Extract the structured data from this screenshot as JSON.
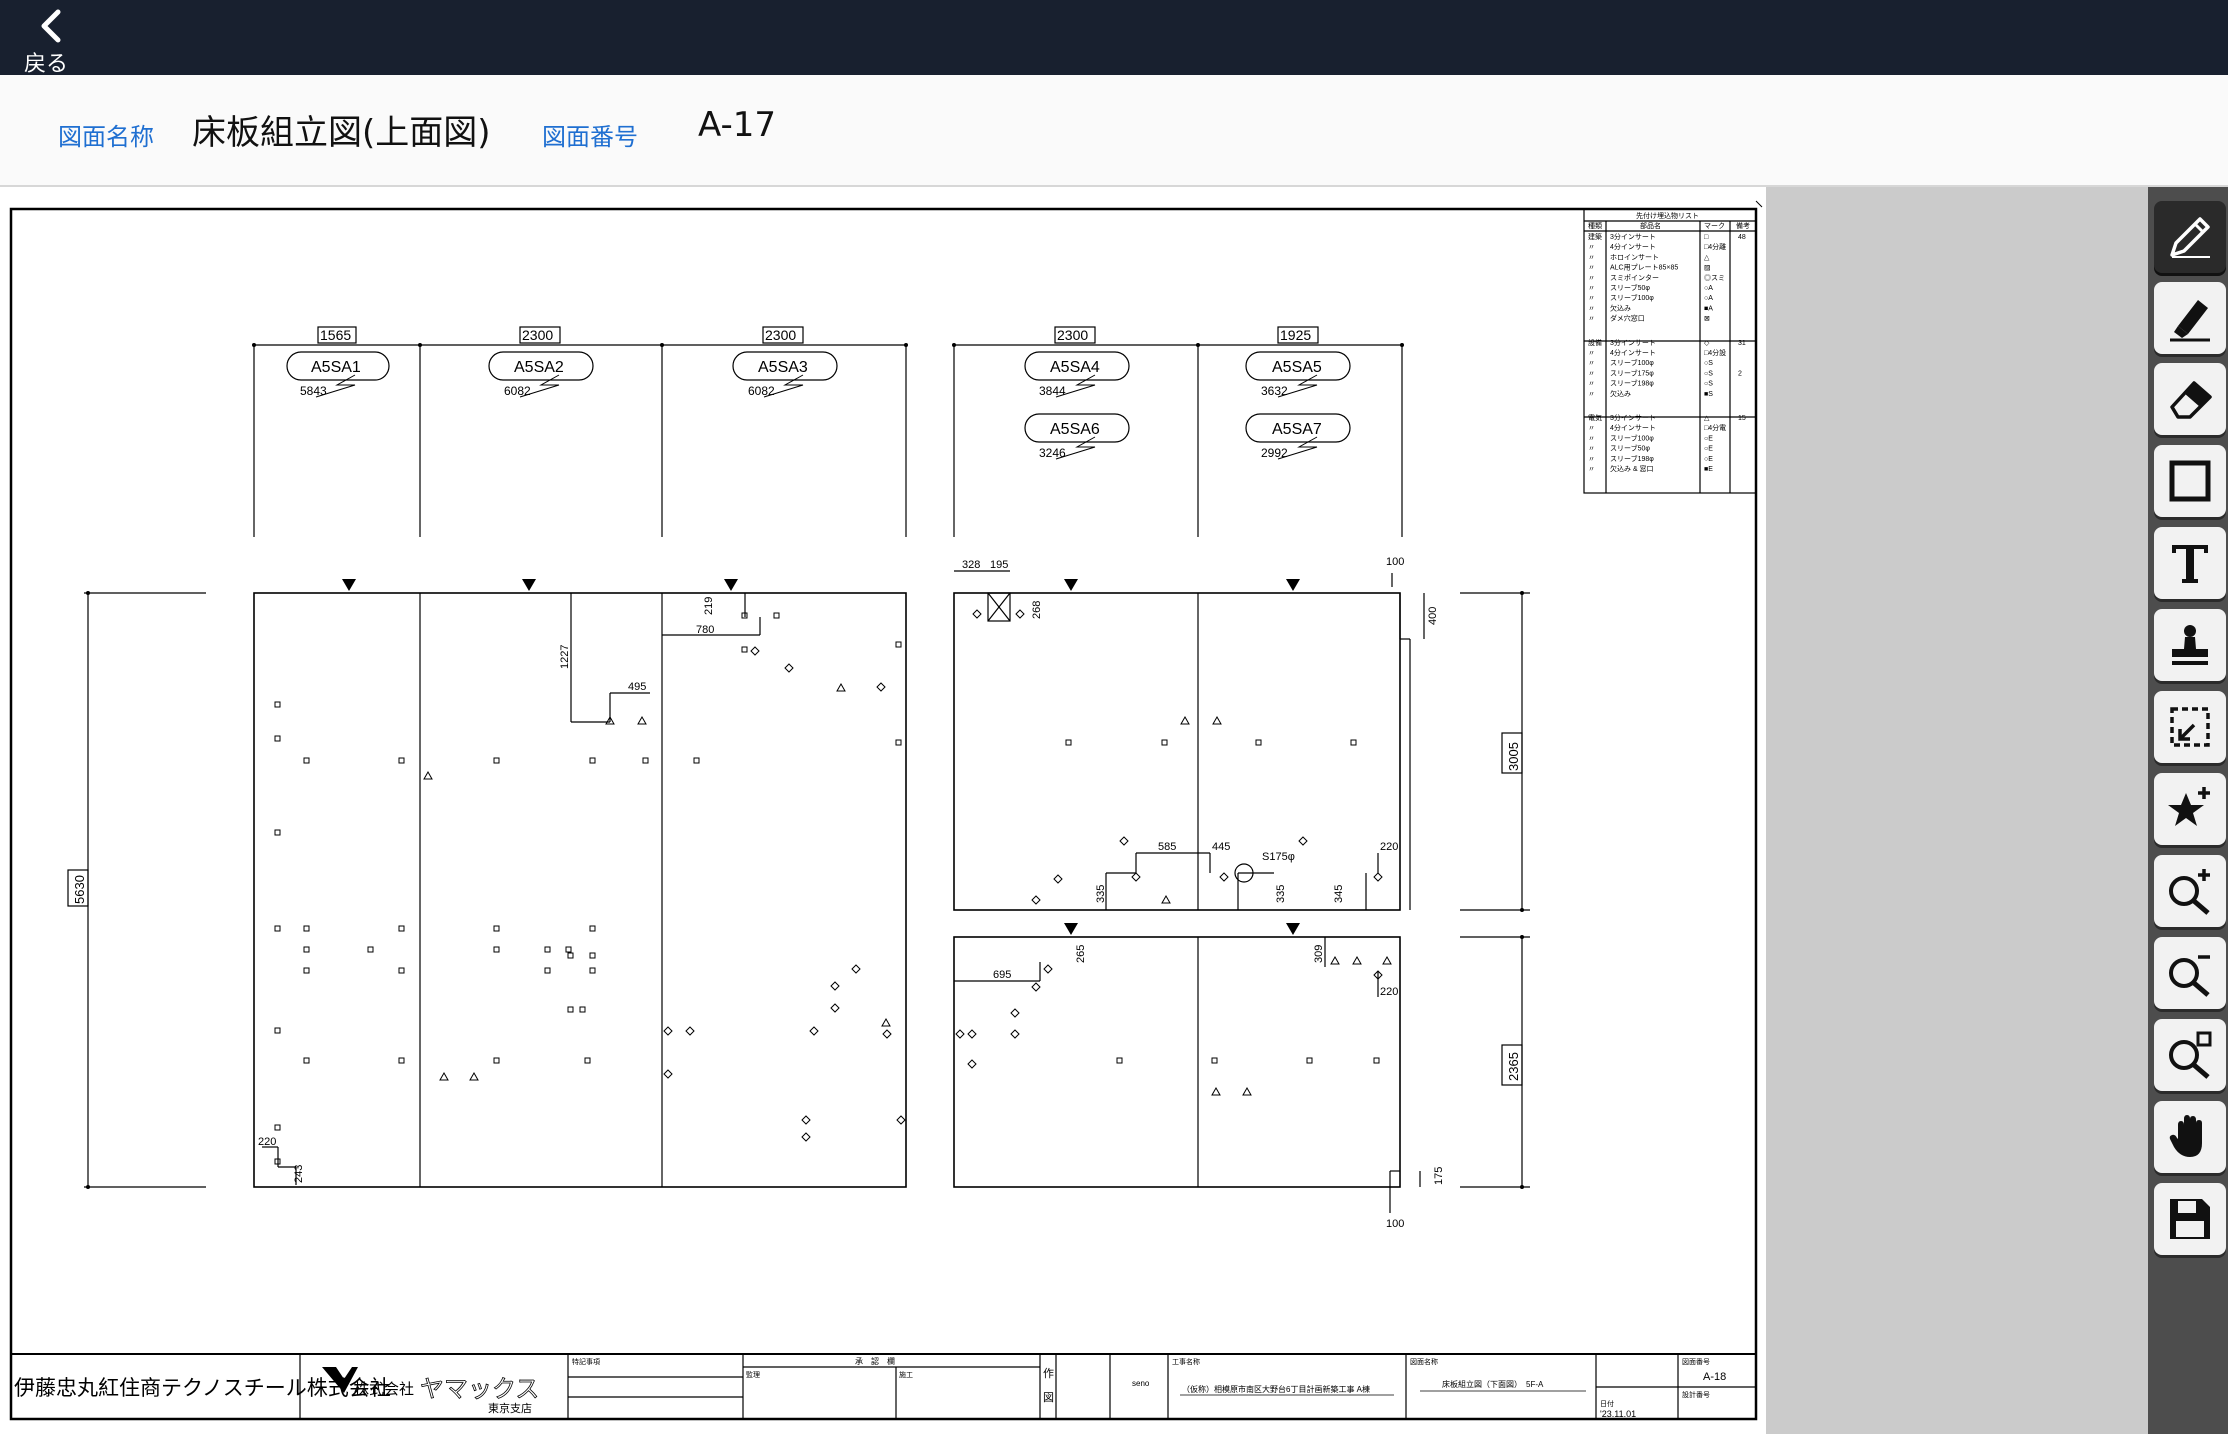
{
  "header": {
    "back_label": "戻る"
  },
  "info": {
    "name_label": "図面名称",
    "name_value": "床板組立図(上面図)",
    "number_label": "図面番号",
    "number_value": "A-17"
  },
  "toolbar": {
    "tools": [
      "pen",
      "highlighter",
      "eraser",
      "rectangle",
      "text",
      "stamp",
      "select-region",
      "add-favorite",
      "zoom-in",
      "zoom-out",
      "zoom-fit",
      "pan",
      "save"
    ],
    "active": "pen"
  },
  "drawing": {
    "panels_top": [
      {
        "width": "1565",
        "mark": "A5SA1",
        "length": "5843"
      },
      {
        "width": "2300",
        "mark": "A5SA2",
        "length": "6082"
      },
      {
        "width": "2300",
        "mark": "A5SA3",
        "length": "6082"
      },
      {
        "width": "2300",
        "mark": "A5SA4",
        "length": "3844"
      },
      {
        "width": "1925",
        "mark": "A5SA5",
        "length": "3632"
      }
    ],
    "panels_second": [
      {
        "mark": "A5SA6",
        "length": "3246"
      },
      {
        "mark": "A5SA7",
        "length": "2992"
      }
    ],
    "dims_left": {
      "overall": "5630",
      "d1": "1227",
      "d2": "495",
      "d3": "219",
      "d4": "780",
      "d5": "220",
      "d6": "243"
    },
    "dims_right": {
      "d328": "328",
      "d195": "195",
      "d268": "268",
      "d100a": "100",
      "d400": "400",
      "d3005": "3005",
      "d585": "585",
      "d445": "445",
      "sleeve": "S175φ",
      "d220a": "220",
      "d335a": "335",
      "d335b": "335",
      "d345": "345",
      "d265": "265",
      "d695": "695",
      "d309": "309",
      "d220b": "220",
      "d2365": "2365",
      "d175": "175",
      "d100b": "100"
    },
    "legend": {
      "title": "先付け埋込物リスト",
      "headers": [
        "種類",
        "部品名",
        "マーク",
        "備考"
      ],
      "rows": [
        [
          "建築",
          "3分インサート",
          "□",
          "48"
        ],
        [
          "〃",
          "4分インサート",
          "□4分離",
          ""
        ],
        [
          "〃",
          "ホロインサート",
          "△",
          ""
        ],
        [
          "〃",
          "ALC用プレート85×85",
          "▨",
          ""
        ],
        [
          "〃",
          "スミポインター",
          "◎スミ",
          ""
        ],
        [
          "〃",
          "スリーブ50φ",
          "○A",
          ""
        ],
        [
          "〃",
          "スリーブ100φ",
          "○A",
          ""
        ],
        [
          "〃",
          "欠込み",
          "■A",
          ""
        ],
        [
          "〃",
          "ダメ穴窓口",
          "⊠",
          ""
        ],
        [
          "設備",
          "3分インサート",
          "◇",
          "31"
        ],
        [
          "〃",
          "4分インサート",
          "□4分設",
          ""
        ],
        [
          "〃",
          "スリーブ100φ",
          "○S",
          ""
        ],
        [
          "〃",
          "スリーブ175φ",
          "○S",
          "2"
        ],
        [
          "〃",
          "スリーブ198φ",
          "○S",
          ""
        ],
        [
          "〃",
          "欠込み",
          "■S",
          ""
        ],
        [
          "電気",
          "3分インサート",
          "△",
          "15"
        ],
        [
          "〃",
          "4分インサート",
          "□4分電",
          ""
        ],
        [
          "〃",
          "スリーブ100φ",
          "○E",
          ""
        ],
        [
          "〃",
          "スリーブ50φ",
          "○E",
          ""
        ],
        [
          "〃",
          "スリーブ198φ",
          "○E",
          ""
        ],
        [
          "〃",
          "欠込み & 窓口",
          "■E",
          ""
        ]
      ]
    },
    "title_block": {
      "company": "伊藤忠丸紅住商テクノスチール株式会社",
      "maker_prefix": "株式会社",
      "maker": "ヤマックス",
      "branch": "東京支店",
      "tokki": "特記事項",
      "shonin": "承　認　欄",
      "kanri": "監理",
      "seko": "施工",
      "saku": "作",
      "zu": "図",
      "drafter": "seno",
      "project_label": "工事名称",
      "project": "（仮称）相模原市南区大野台6丁目計画新築工事 A棟",
      "drawing_label": "図面名称",
      "drawing_name": "床板組立図（下面図）　5F-A",
      "number_label": "図面番号",
      "number": "A-18",
      "date_label": "日付",
      "date": "'23.11.01",
      "design_label": "設計番号"
    }
  }
}
